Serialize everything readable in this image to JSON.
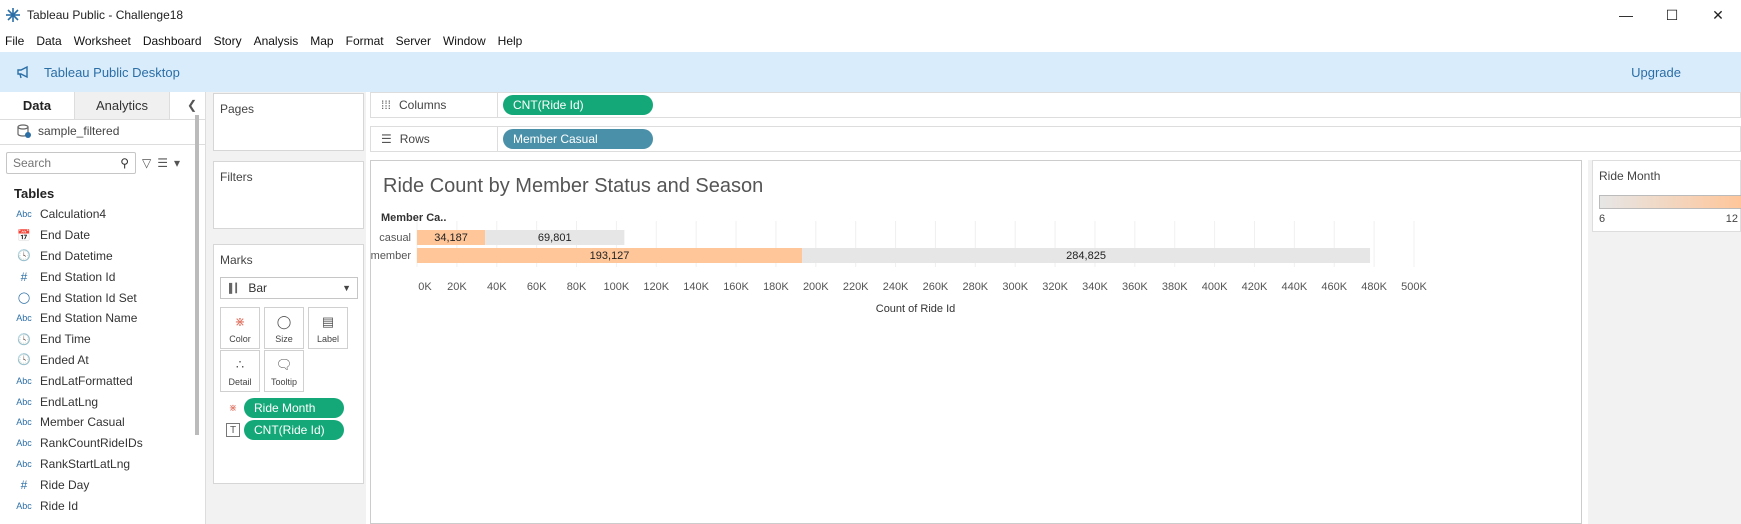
{
  "window": {
    "title": "Tableau Public - Challenge18"
  },
  "menu": [
    "File",
    "Data",
    "Worksheet",
    "Dashboard",
    "Story",
    "Analysis",
    "Map",
    "Format",
    "Server",
    "Window",
    "Help"
  ],
  "banner": {
    "brand": "Tableau Public Desktop",
    "upgrade": "Upgrade"
  },
  "left_pane": {
    "tabs": {
      "data": "Data",
      "analytics": "Analytics"
    },
    "datasource": "sample_filtered",
    "search_placeholder": "Search",
    "tables_header": "Tables",
    "fields": [
      {
        "type": "Abc",
        "name": "Calculation4"
      },
      {
        "type": "date",
        "name": "End Date"
      },
      {
        "type": "datetime",
        "name": "End Datetime"
      },
      {
        "type": "#",
        "name": "End Station Id"
      },
      {
        "type": "set",
        "name": "End Station Id Set"
      },
      {
        "type": "Abc",
        "name": "End Station Name"
      },
      {
        "type": "datetime",
        "name": "End Time"
      },
      {
        "type": "datetime",
        "name": "Ended At"
      },
      {
        "type": "Abc",
        "name": "EndLatFormatted"
      },
      {
        "type": "Abc",
        "name": "EndLatLng"
      },
      {
        "type": "Abc",
        "name": "Member Casual"
      },
      {
        "type": "Abc",
        "name": "RankCountRideIDs"
      },
      {
        "type": "Abc",
        "name": "RankStartLatLng"
      },
      {
        "type": "#",
        "name": "Ride Day"
      },
      {
        "type": "Abc",
        "name": "Ride Id"
      }
    ]
  },
  "cards": {
    "pages": "Pages",
    "filters": "Filters",
    "marks": "Marks",
    "mark_type": "Bar",
    "mark_buttons": [
      "Color",
      "Size",
      "Label",
      "Detail",
      "Tooltip"
    ],
    "mark_pills": [
      "Ride Month",
      "CNT(Ride Id)"
    ]
  },
  "shelves": {
    "columns_label": "Columns",
    "columns_pill": "CNT(Ride Id)",
    "rows_label": "Rows",
    "rows_pill": "Member Casual"
  },
  "colors": {
    "green_pill": "#14a878",
    "blue_pill": "#4a90a8",
    "bar_orange": "#ffc69a",
    "bar_gray": "#e6e6e6",
    "banner": "#d9ecfb"
  },
  "chart_data": {
    "type": "bar",
    "title": "Ride Count by Member Status and Season",
    "row_header": "Member Ca..",
    "xlabel": "Count of Ride Id",
    "xlim": [
      0,
      500000
    ],
    "x_ticks": [
      "0K",
      "20K",
      "40K",
      "60K",
      "80K",
      "100K",
      "120K",
      "140K",
      "160K",
      "180K",
      "200K",
      "220K",
      "240K",
      "260K",
      "280K",
      "300K",
      "320K",
      "340K",
      "360K",
      "380K",
      "400K",
      "420K",
      "440K",
      "460K",
      "480K",
      "500K"
    ],
    "categories": [
      "casual",
      "member"
    ],
    "stacked": true,
    "series": [
      {
        "values": [
          34187,
          193127
        ],
        "color": "#ffc69a"
      },
      {
        "values": [
          69801,
          284825
        ],
        "color": "#e6e6e6"
      }
    ],
    "data_labels": [
      [
        "34,187",
        "69,801"
      ],
      [
        "193,127",
        "284,825"
      ]
    ]
  },
  "legend": {
    "title": "Ride Month",
    "min": "6",
    "max": "12"
  }
}
